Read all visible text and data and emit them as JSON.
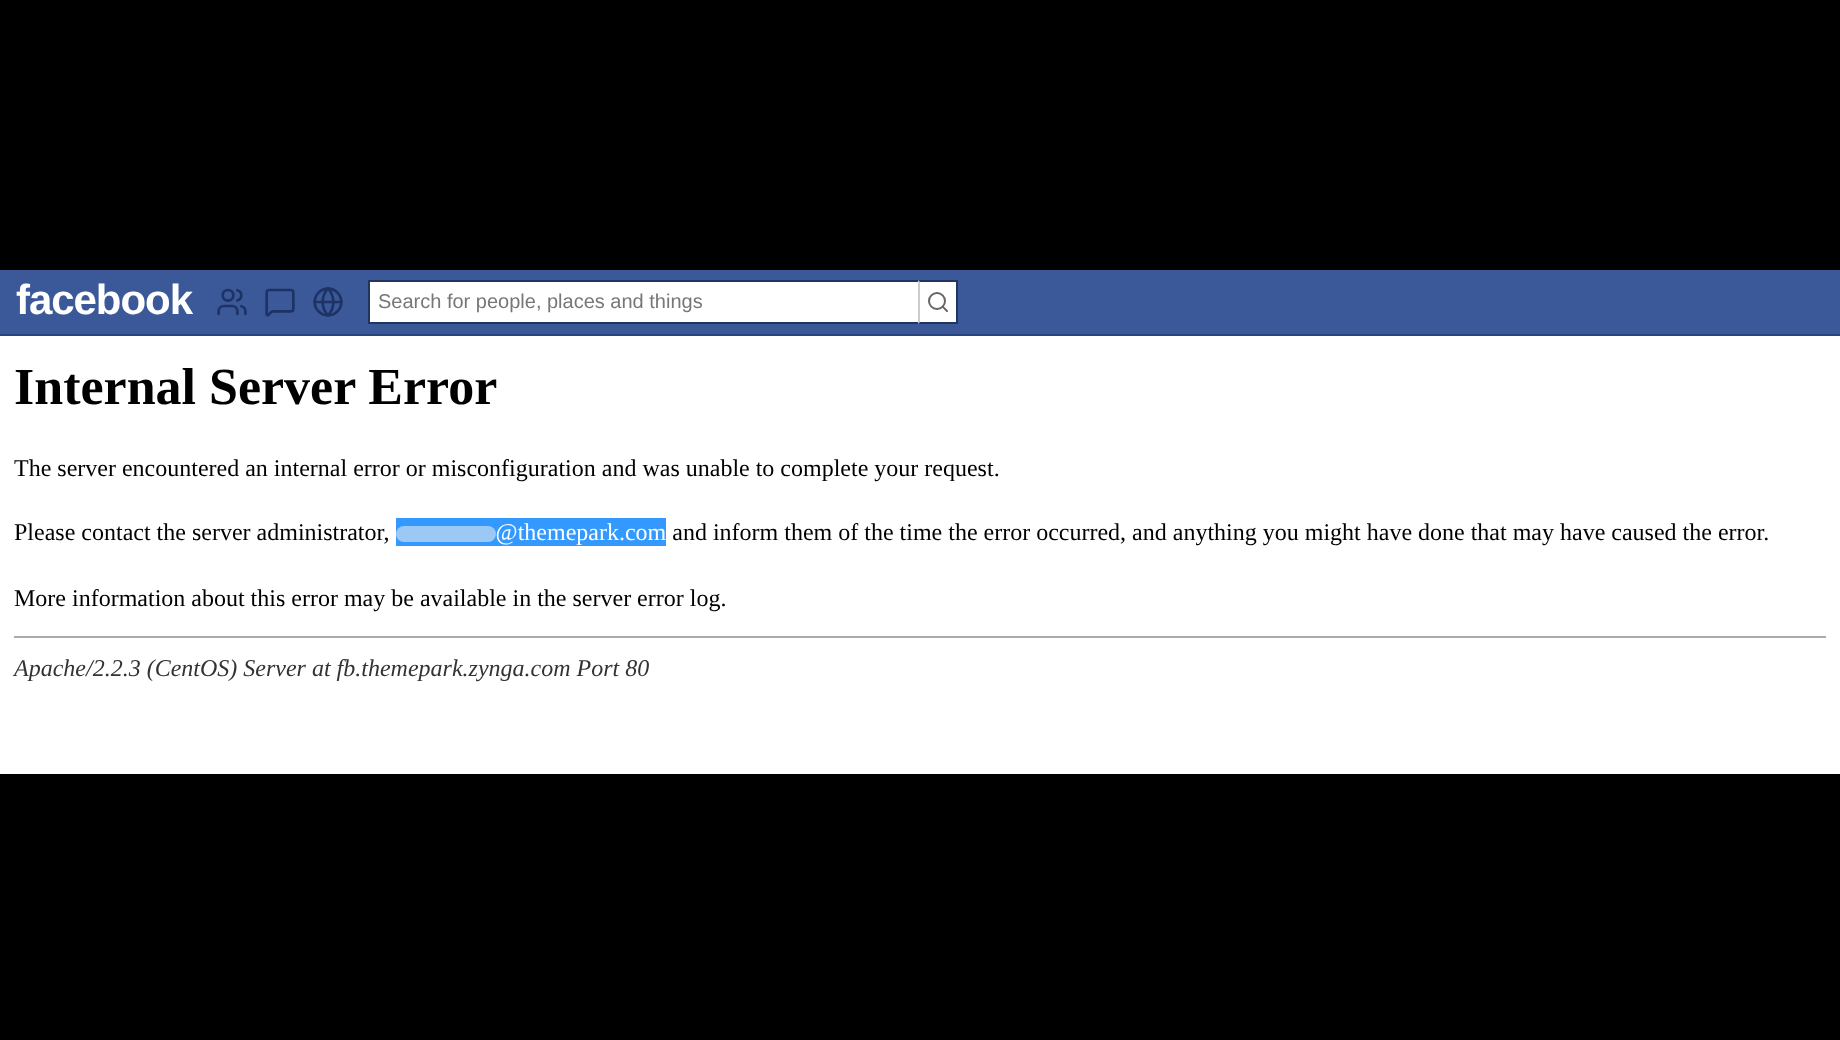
{
  "top_bar": {
    "logo": "facebook",
    "search": {
      "placeholder": "Search for people, places and things"
    }
  },
  "page": {
    "title": "Internal Server Error",
    "message": "The server encountered an internal error or misconfiguration and was unable to complete your request.",
    "contact": {
      "before": "Please contact the server administrator,",
      "email": "@themepark.com",
      "email_highlighted": true,
      "after": "and inform them of the time the error occurred, and anything you might have done that may have caused the error."
    },
    "more_info": "More information about this error may be available in the server error log.",
    "signature": "Apache/2.2.3 (CentOS) Server at fb.themepark.zynga.com Port 80"
  }
}
